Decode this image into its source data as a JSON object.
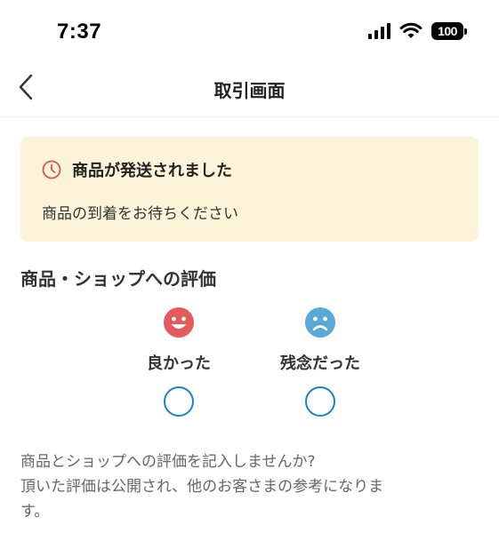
{
  "status_bar": {
    "time": "7:37",
    "battery": "100"
  },
  "nav": {
    "title": "取引画面",
    "back_icon": "chevron-left-icon"
  },
  "notice": {
    "icon": "clock-icon",
    "title": "商品が発送されました",
    "message": "商品の到着をお待ちください",
    "background": "#fdf3d8",
    "icon_color": "#d9534f"
  },
  "rating": {
    "section_title": "商品・ショップへの評価",
    "options": [
      {
        "label": "良かった",
        "icon": "smiley-face-icon",
        "color": "#e55a5a",
        "selected": false
      },
      {
        "label": "残念だった",
        "icon": "sad-face-icon",
        "color": "#5aa9d6",
        "selected": false
      }
    ],
    "radio_color": "#1a82c8"
  },
  "prompt": {
    "line1": "商品とショップへの評価を記入しませんか?",
    "line2": "頂いた評価は公開され、他のお客さまの参考になりま",
    "line3": "す。"
  }
}
